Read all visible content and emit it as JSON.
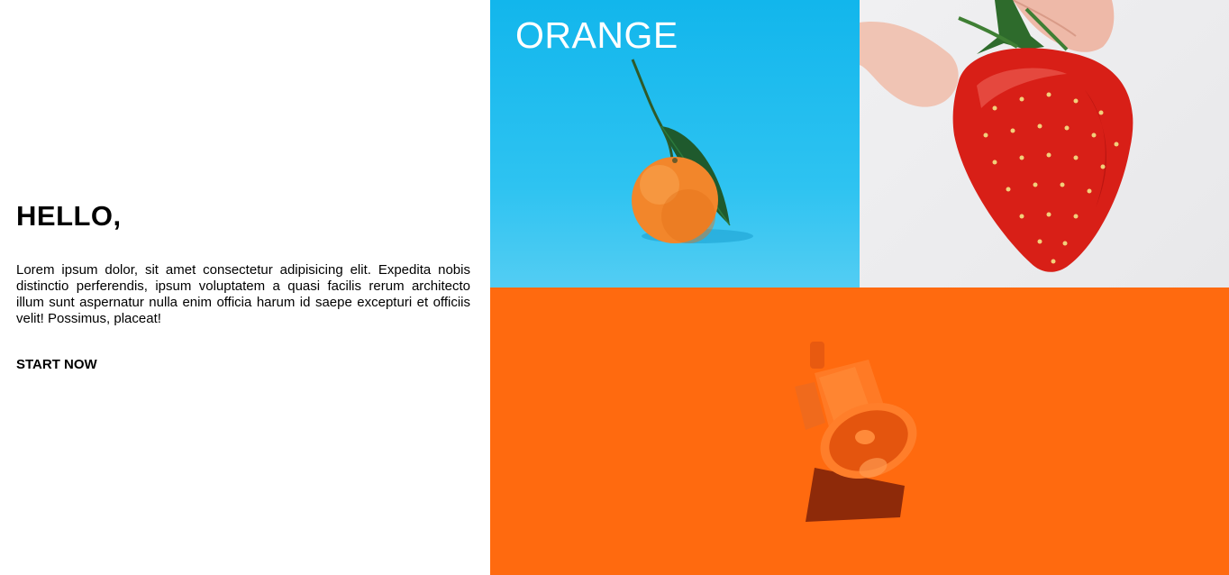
{
  "hero": {
    "title": "HELLO,",
    "text": "Lorem ipsum dolor, sit amet consectetur adipisicing elit. Expedita nobis distinctio perferendis, ipsum voluptatem a quasi facilis rerum architecto illum sunt aspernatur nulla enim officia harum id saepe excepturi et officiis velit! Possimus, placeat!",
    "cta_label": "START NOW"
  },
  "gallery": {
    "tiles": [
      {
        "label": "ORANGE",
        "image": "orange-photo"
      },
      {
        "image": "strawberry-photo"
      },
      {
        "image": "megaphone-photo"
      }
    ]
  },
  "colors": {
    "orange_tile_bg": "#2ec3f1",
    "strawberry_tile_bg": "#ececee",
    "megaphone_tile_bg": "#ff6a0f",
    "text": "#000000"
  }
}
